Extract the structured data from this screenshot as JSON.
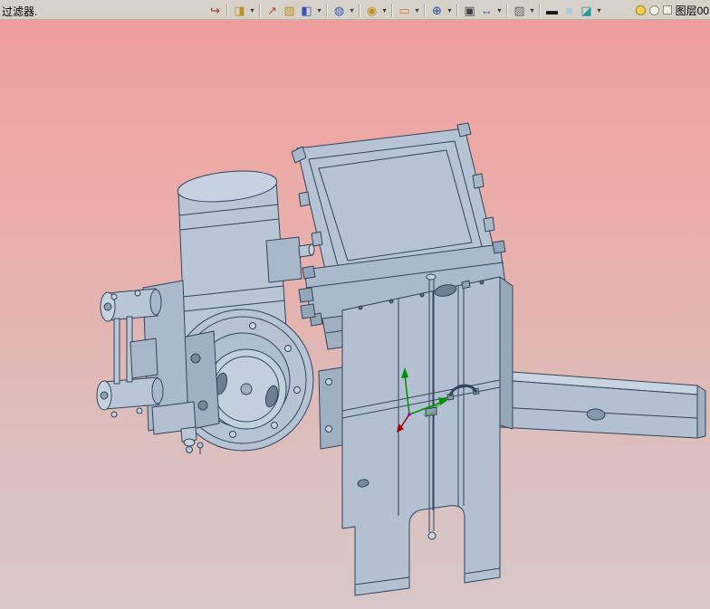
{
  "topbar": {
    "prompt": "过滤器.",
    "layer": "图层00",
    "icons": [
      {
        "name": "finish-sketch-icon",
        "glyph": "↪",
        "color": "#a03030",
        "sep": true
      },
      {
        "name": "style-fill-icon",
        "glyph": "◨",
        "color": "#c09020",
        "dropdown": true,
        "sep": true
      },
      {
        "name": "sketch-pen-icon",
        "glyph": "↗",
        "color": "#b04848"
      },
      {
        "name": "extrude-box-icon",
        "glyph": "▧",
        "color": "#c09020"
      },
      {
        "name": "solid-cube-icon",
        "glyph": "◧",
        "color": "#3558b8",
        "dropdown": true,
        "sep": true
      },
      {
        "name": "sphere-feature-icon",
        "glyph": "◍",
        "color": "#3558b8",
        "dropdown": true,
        "sep": true
      },
      {
        "name": "fan-pattern-icon",
        "glyph": "◉",
        "color": "#c09020",
        "dropdown": true,
        "sep": true
      },
      {
        "name": "sketch-plane-icon",
        "glyph": "▭",
        "color": "#d87828",
        "dropdown": true,
        "sep": true
      },
      {
        "name": "locate-icon",
        "glyph": "⊕",
        "color": "#2848a8",
        "dropdown": true,
        "sep": true
      },
      {
        "name": "center-point-icon",
        "glyph": "▣",
        "color": "#404040"
      },
      {
        "name": "dimension-icon",
        "glyph": "↔",
        "color": "#3558b8",
        "dropdown": true,
        "sep": true
      },
      {
        "name": "display-mode-icon",
        "glyph": "▨",
        "color": "#606870",
        "dropdown": true,
        "sep": true
      },
      {
        "name": "line-width-icon",
        "glyph": "▬",
        "color": "#181818"
      },
      {
        "name": "bg-color-icon",
        "glyph": "■",
        "color": "#a9cbe0"
      },
      {
        "name": "layers-icon",
        "glyph": "◪",
        "color": "#1f9898",
        "dropdown": true
      }
    ],
    "right_icons": [
      "light-on-icon",
      "light-off-icon",
      "layer-color-swatch"
    ],
    "colors": {
      "bar_bg": "#d6d2ca"
    }
  },
  "viewport": {
    "bg_top": "#ee9d9d",
    "bg_bottom": "#d7c7c8",
    "model_fill": "#b5c3d4",
    "model_fill_light": "#c6d2e0",
    "model_fill_dark": "#97a8bb",
    "model_stroke": "#32455a",
    "triad_green": "#008f00",
    "triad_red": "#a00000"
  }
}
